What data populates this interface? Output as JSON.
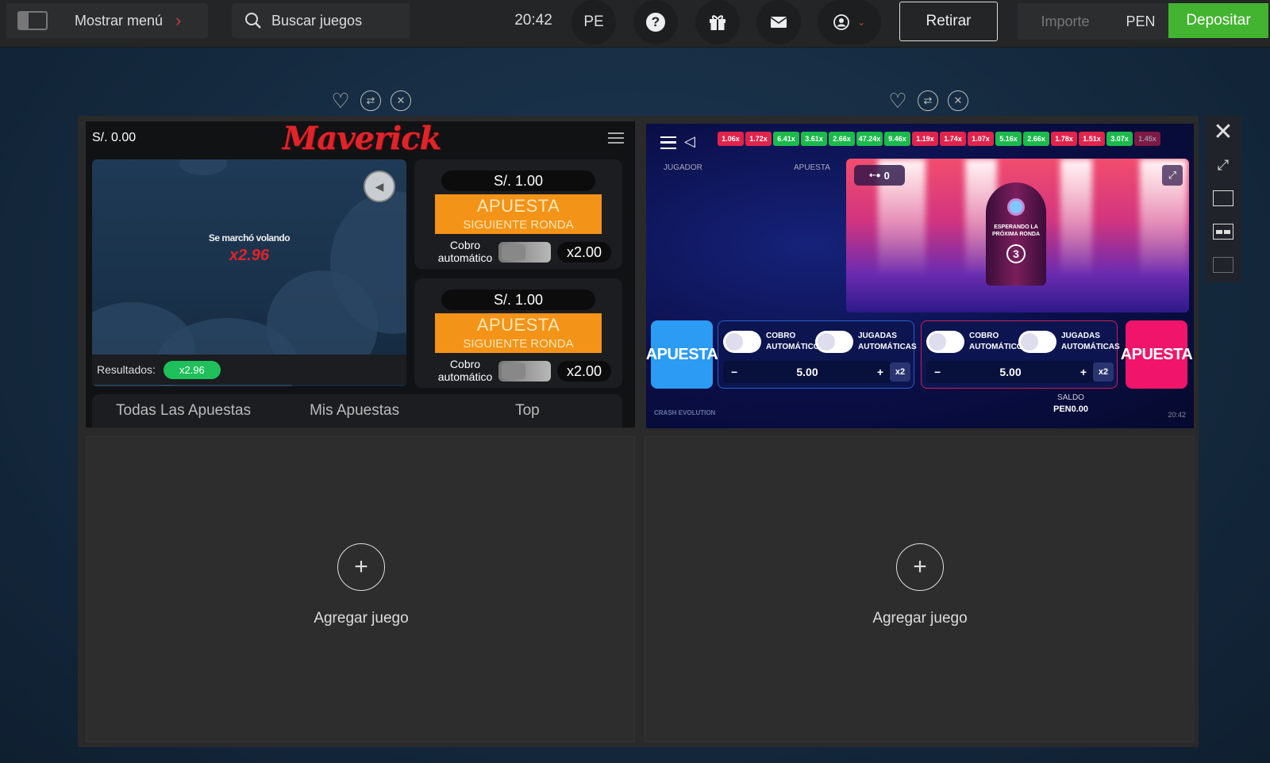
{
  "topbar": {
    "menu_label": "Mostrar menú",
    "search_placeholder": "Buscar juegos",
    "time": "20:42",
    "lang": "PE",
    "retirar": "Retirar",
    "importe_placeholder": "Importe",
    "currency": "PEN",
    "depositar": "Depositar"
  },
  "maverick": {
    "balance": "S/. 0.00",
    "logo": "Maverick",
    "flew_away": "Se marchó volando",
    "multiplier": "x2.96",
    "results_label": "Resultados:",
    "results": [
      "x2.96"
    ],
    "bet_panels": [
      {
        "amount": "S/. 1.00",
        "button_title": "APUESTA",
        "button_sub": "SIGUIENTE RONDA",
        "cashout_label": "Cobro automático",
        "cashout_value": "x2.00"
      },
      {
        "amount": "S/. 1.00",
        "button_title": "APUESTA",
        "button_sub": "SIGUIENTE RONDA",
        "cashout_label": "Cobro automático",
        "cashout_value": "x2.00"
      }
    ],
    "tabs": [
      "Todas Las Apuestas",
      "Mis Apuestas",
      "Top"
    ]
  },
  "crash": {
    "history": [
      "1.06x",
      "1.72x",
      "6.41x",
      "3.61x",
      "2.66x",
      "47.24x",
      "9.46x",
      "1.19x",
      "1.74x",
      "1.07x",
      "5.16x",
      "2.66x",
      "1.78x",
      "1.51x",
      "3.07x",
      "1.45x"
    ],
    "history_colors": [
      "#e0244c",
      "#e0244c",
      "#1cba4c",
      "#1cba4c",
      "#1cba4c",
      "#1cba4c",
      "#1cba4c",
      "#e0244c",
      "#e0244c",
      "#e0244c",
      "#1cba4c",
      "#1cba4c",
      "#e0244c",
      "#e0244c",
      "#1cba4c",
      "#e0244c"
    ],
    "col_jugador": "JUGADOR",
    "col_apuesta": "APUESTA",
    "players": "0",
    "waiting": "ESPERANDO LA PRÓXIMA RONDA",
    "countdown": "3",
    "bet_button": "APUESTA",
    "bets": [
      {
        "auto_cashout": "COBRO AUTOMÁTICO",
        "auto_play": "JUGADAS AUTOMÁTICAS",
        "amount": "5.00",
        "x2": "x2"
      },
      {
        "auto_cashout": "COBRO AUTOMÁTICO",
        "auto_play": "JUGADAS AUTOMÁTICAS",
        "amount": "5.00",
        "x2": "x2"
      }
    ],
    "saldo_label": "SALDO",
    "saldo_value": "PEN0.00",
    "brand": "CRASH EVOLUTION",
    "time": "20:42"
  },
  "slots": [
    {
      "label": "Agregar juego"
    },
    {
      "label": "Agregar juego"
    }
  ],
  "accent": {
    "deposit": "#43b430",
    "maverick_orange": "#f39318",
    "crash_blue": "#2b9bf4",
    "crash_pink": "#f0156a"
  }
}
